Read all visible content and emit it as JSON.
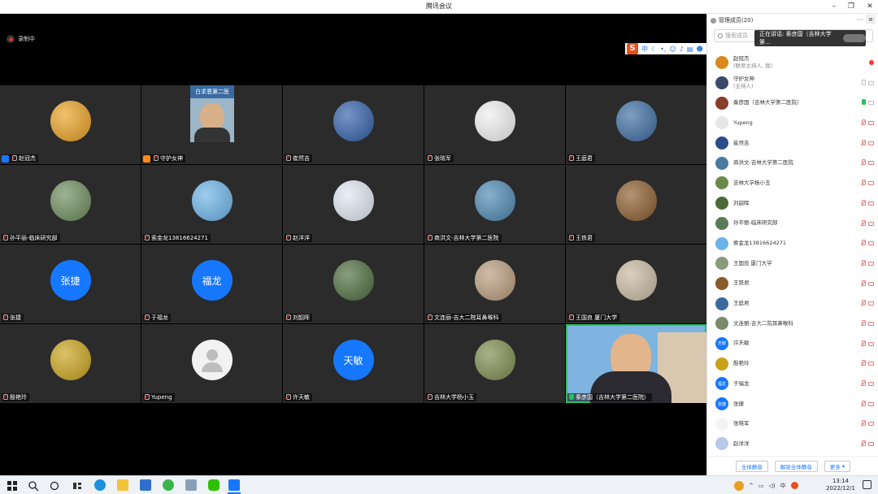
{
  "window": {
    "title": "腾讯会议"
  },
  "recording": {
    "label": "录制中"
  },
  "ime": {
    "items": [
      "中"
    ]
  },
  "participants_panel": {
    "title": "管理成员(20)",
    "search_placeholder": "搜索成员",
    "speaking_label": "正在讲话: 秦彦国（吉林大学第...",
    "buttons": {
      "mute_all": "全体静音",
      "unmute_all": "解除全体静音",
      "more": "更多"
    },
    "members": [
      {
        "name": "赵冠杰",
        "sub": "(联席主持人, 我)",
        "mic": "rec",
        "avatar_color": "#d98a1a"
      },
      {
        "name": "守护女神",
        "sub": "(主持人)",
        "mic": "idle",
        "avatar_color": "#3a4a6a"
      },
      {
        "name": "秦彦国（吉林大学第二医院）",
        "sub": "",
        "mic": "on",
        "avatar_color": "#8a3b2a"
      },
      {
        "name": "Yupeng",
        "sub": "",
        "mic": "off",
        "avatar_color": "#e6e6e6"
      },
      {
        "name": "崔然吉",
        "sub": "",
        "mic": "off",
        "avatar_color": "#2a4c8a"
      },
      {
        "name": "商洪文-吉林大学第二医院",
        "sub": "",
        "mic": "off",
        "avatar_color": "#4a7aa0"
      },
      {
        "name": "吉林大学杨小玉",
        "sub": "",
        "mic": "off",
        "avatar_color": "#6a8a4a"
      },
      {
        "name": "刘韶晖",
        "sub": "",
        "mic": "off",
        "avatar_color": "#4a6a3a"
      },
      {
        "name": "孙平丽-临床研究部",
        "sub": "",
        "mic": "off",
        "avatar_color": "#5a7a5a"
      },
      {
        "name": "索金龙13816624271",
        "sub": "",
        "mic": "off",
        "avatar_color": "#69b3e8"
      },
      {
        "name": "王国良 厦门大学",
        "sub": "",
        "mic": "off",
        "avatar_color": "#8a9a7a"
      },
      {
        "name": "王铁君",
        "sub": "",
        "mic": "off",
        "avatar_color": "#8a5a2a"
      },
      {
        "name": "王庭君",
        "sub": "",
        "mic": "off",
        "avatar_color": "#3a6aa0"
      },
      {
        "name": "文连丽-吉大二院耳鼻喉科",
        "sub": "",
        "mic": "off",
        "avatar_color": "#7a8a6a"
      },
      {
        "name": "许天敏",
        "sub": "",
        "mic": "off",
        "avatar_color": "#1677ff",
        "text": "天敏"
      },
      {
        "name": "殷艳玲",
        "sub": "",
        "mic": "off",
        "avatar_color": "#c9a21a"
      },
      {
        "name": "于福龙",
        "sub": "",
        "mic": "off",
        "avatar_color": "#1677ff",
        "text": "福龙"
      },
      {
        "name": "张捷",
        "sub": "",
        "mic": "off",
        "avatar_color": "#1677ff",
        "text": "张捷"
      },
      {
        "name": "张晓军",
        "sub": "",
        "mic": "off",
        "avatar_color": "#f4f4f4"
      },
      {
        "name": "赵洋洋",
        "sub": "",
        "mic": "off",
        "avatar_color": "#b8c8e8"
      }
    ]
  },
  "tiles": [
    {
      "name": "赵冠杰",
      "badge": "blue",
      "avatar_color": "#e8a020",
      "text": ""
    },
    {
      "name": "守护女神",
      "badge": "orange",
      "video": true,
      "overlay_text": "白求恩第二医"
    },
    {
      "name": "崔然吉",
      "avatar_color": "#2f5da8",
      "text": ""
    },
    {
      "name": "张晓军",
      "avatar_color": "#f0f0f0",
      "text": ""
    },
    {
      "name": "王庭君",
      "avatar_color": "#3a6aa0",
      "text": ""
    },
    {
      "name": "孙平丽-临床研究部",
      "avatar_color": "#6a8a5a",
      "text": ""
    },
    {
      "name": "索金龙13816624271",
      "avatar_color": "#69b3e8",
      "text": ""
    },
    {
      "name": "赵洋洋",
      "avatar_color": "#dfe6f2",
      "text": ""
    },
    {
      "name": "商洪文-吉林大学第二医院",
      "avatar_color": "#4a86b0",
      "text": ""
    },
    {
      "name": "王铁君",
      "avatar_color": "#8a5a2a",
      "text": ""
    },
    {
      "name": "张捷",
      "avatar_color": "#1677ff",
      "text": "张捷"
    },
    {
      "name": "于福龙",
      "avatar_color": "#1677ff",
      "text": "福龙"
    },
    {
      "name": "刘韶晖",
      "avatar_color": "#4a6a3a",
      "text": ""
    },
    {
      "name": "文连丽-吉大二院耳鼻喉科",
      "avatar_color": "#b89a7a",
      "text": ""
    },
    {
      "name": "王国良 厦门大学",
      "avatar_color": "#c8b8a0",
      "text": ""
    },
    {
      "name": "殷艳玲",
      "avatar_color": "#c9a21a",
      "text": ""
    },
    {
      "name": "Yupeng",
      "avatar_color": "#f2f2f2",
      "text": "",
      "placeholder": true
    },
    {
      "name": "许天敏",
      "avatar_color": "#1677ff",
      "text": "天敏"
    },
    {
      "name": "吉林大学杨小玉",
      "avatar_color": "#7a8a4a",
      "text": ""
    },
    {
      "name": "秦彦国（吉林大学第二医院）",
      "video": true,
      "speaking": true
    }
  ],
  "taskbar": {
    "time": "13:14",
    "date": "2022/12/1",
    "ime_lang": "中"
  }
}
